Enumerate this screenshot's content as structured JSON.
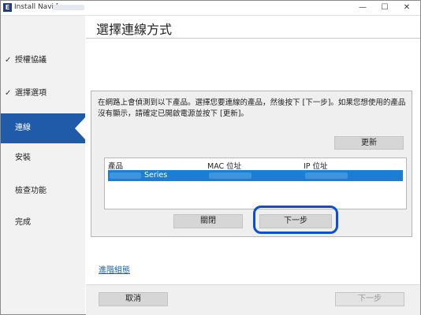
{
  "window": {
    "app_icon": "E",
    "title": "Install Navi [",
    "controls": {
      "minimize": "—",
      "maximize": "☐",
      "close": "✕"
    }
  },
  "sidebar": {
    "items": [
      {
        "label": "授權協議",
        "done": true,
        "check": "✓"
      },
      {
        "label": "選擇選項",
        "done": true,
        "check": "✓"
      },
      {
        "label": "連線",
        "active": true
      },
      {
        "label": "安裝"
      },
      {
        "label": "檢查功能"
      },
      {
        "label": "完成"
      }
    ]
  },
  "page_title": "選擇連線方式",
  "panel": {
    "instruction": "在網路上會偵測到以下產品。選擇您要連線的產品，然後按下 [下一步]。如果您想使用的產品沒有顯示，請確定已開啟電源並按下 [更新]。",
    "refresh_label": "更新",
    "table": {
      "columns": [
        "產品",
        "MAC 位址",
        "IP 位址"
      ],
      "rows": [
        {
          "product": "Series",
          "selected": true
        }
      ]
    },
    "close_label": "關閉",
    "next_label": "下一步"
  },
  "advanced_link": "進階組態",
  "footer": {
    "cancel_label": "取消",
    "next_label": "下一步",
    "next_enabled": false
  },
  "colors": {
    "accent": "#1f5ba8",
    "selection": "#1a7fd4",
    "highlight": "#0b4fd8"
  }
}
